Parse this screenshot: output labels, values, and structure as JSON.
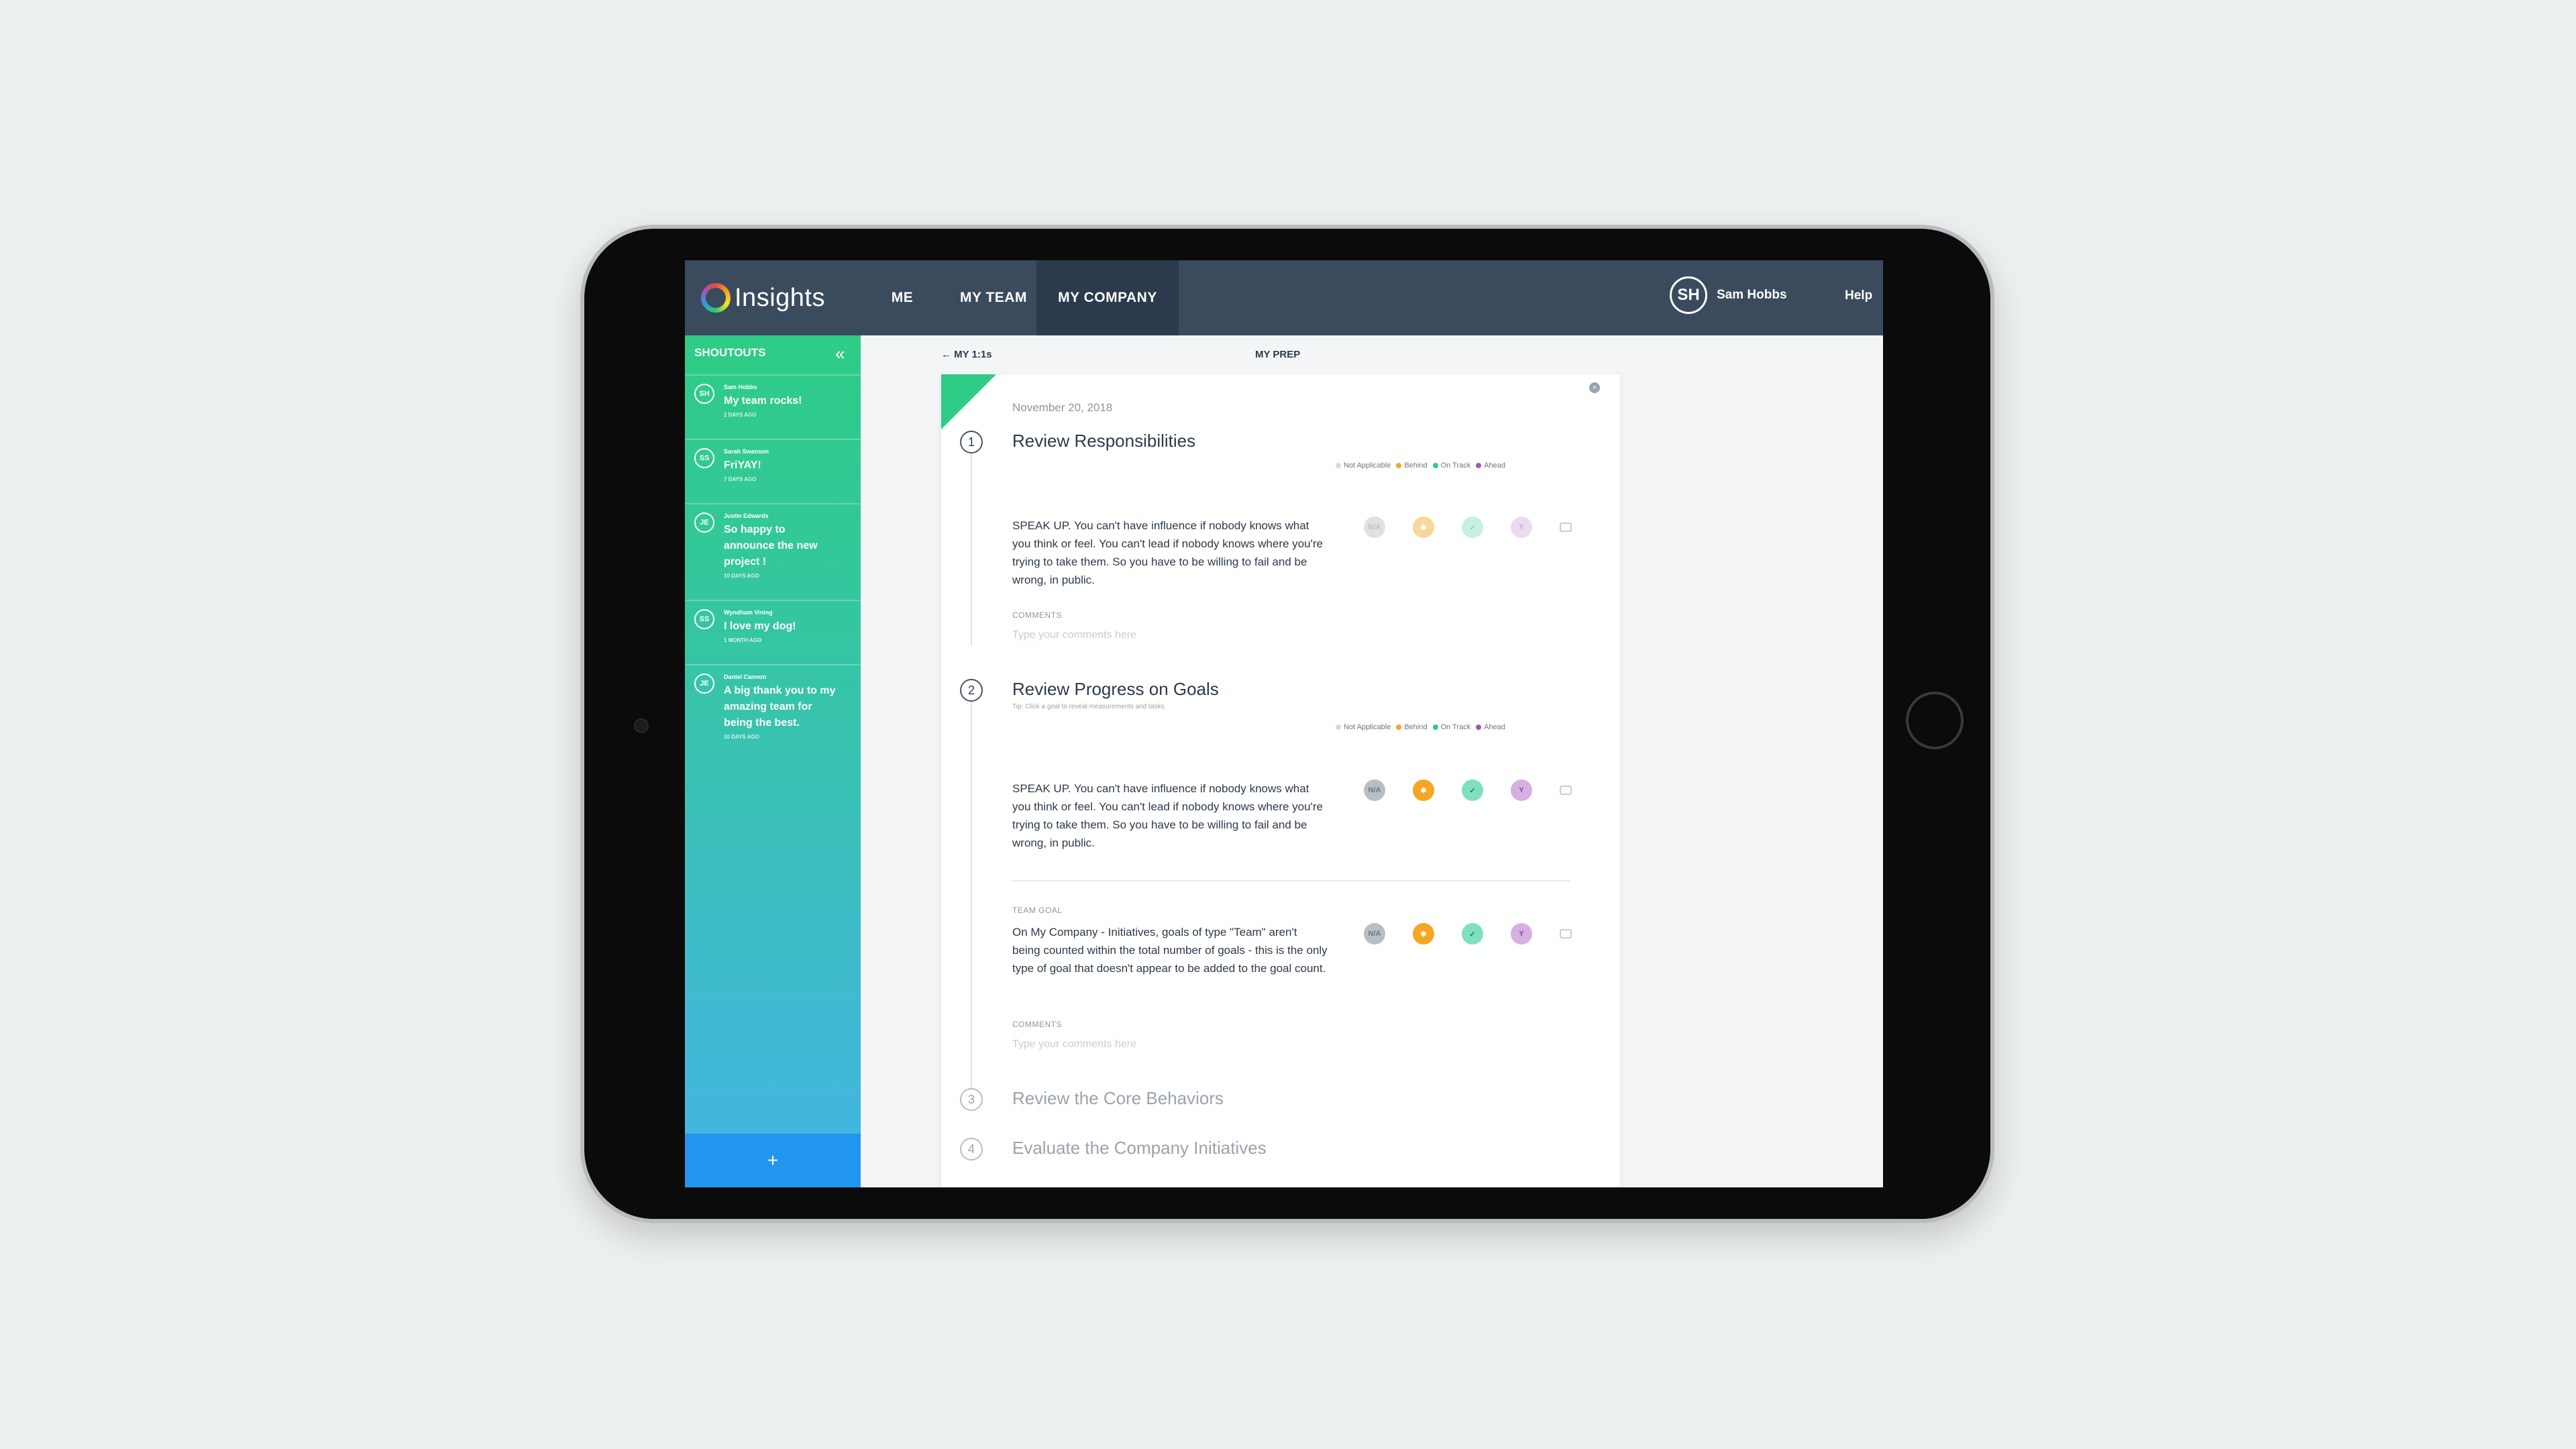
{
  "app": {
    "name": "Insights"
  },
  "nav": {
    "tabs": [
      {
        "label": "ME",
        "active": false
      },
      {
        "label": "MY TEAM",
        "active": false
      },
      {
        "label": "MY COMPANY",
        "active": true
      }
    ],
    "user": {
      "initials": "SH",
      "name": "Sam Hobbs"
    },
    "help": "Help"
  },
  "sidebar": {
    "title": "SHOUTOUTS",
    "collapse_icon": "double-chevron-left-icon",
    "items": [
      {
        "initials": "SH",
        "name": "Sam Hobbs",
        "message": "My team rocks!",
        "ago": "2 DAYS AGO"
      },
      {
        "initials": "SS",
        "name": "Sarah Swanson",
        "message": "FriYAY!",
        "ago": "7 DAYS AGO"
      },
      {
        "initials": "JE",
        "name": "Justin Edwards",
        "message": "So happy to announce the new project !",
        "ago": "10 DAYS AGO"
      },
      {
        "initials": "SS",
        "name": "Wyndham Vining",
        "message": "I love my dog!",
        "ago": "1 MONTH AGO"
      },
      {
        "initials": "JE",
        "name": "Daniel Cannon",
        "message": "A big thank you to my amazing team for being the best.",
        "ago": "10 DAYS AGO"
      }
    ],
    "add_label": "+"
  },
  "breadcrumb": "← MY 1:1s",
  "page_title": "MY PREP",
  "prep": {
    "date": "November 20, 2018",
    "legend": [
      "Not Applicable",
      "Behind",
      "On Track",
      "Ahead"
    ],
    "legend_colors": [
      "#d5d9dd",
      "#f5a623",
      "#2ecc86",
      "#9b59b6"
    ],
    "rating_labels": {
      "na": "N/A"
    },
    "sections": [
      {
        "number": "1",
        "title": "Review Responsibilities",
        "items": [
          {
            "text": "SPEAK UP. You can't have influence if nobody knows what you think or feel.  You can't lead if nobody knows where you're trying to take them.  So you have to be willing to fail and be wrong, in public."
          }
        ],
        "comments_label": "COMMENTS",
        "comments_placeholder": "Type your comments here"
      },
      {
        "number": "2",
        "title": "Review Progress on Goals",
        "tip": "Tip: Click a goal to reveal measurements and tasks.",
        "items": [
          {
            "text": "SPEAK UP. You can't have influence if nobody knows what you think or feel.  You can't lead if nobody knows where you're trying to take them.  So you have to be willing to fail and be wrong, in public."
          },
          {
            "label": "TEAM GOAL",
            "text": "On My Company - Initiatives, goals of type \"Team\" aren't being counted within the total number of goals - this is the only type of goal that doesn't appear to be added to the goal count."
          }
        ],
        "comments_label": "COMMENTS",
        "comments_placeholder": "Type your comments here"
      },
      {
        "number": "3",
        "title": "Review the Core Behaviors"
      },
      {
        "number": "4",
        "title": "Evaluate the Company Initiatives"
      }
    ]
  }
}
